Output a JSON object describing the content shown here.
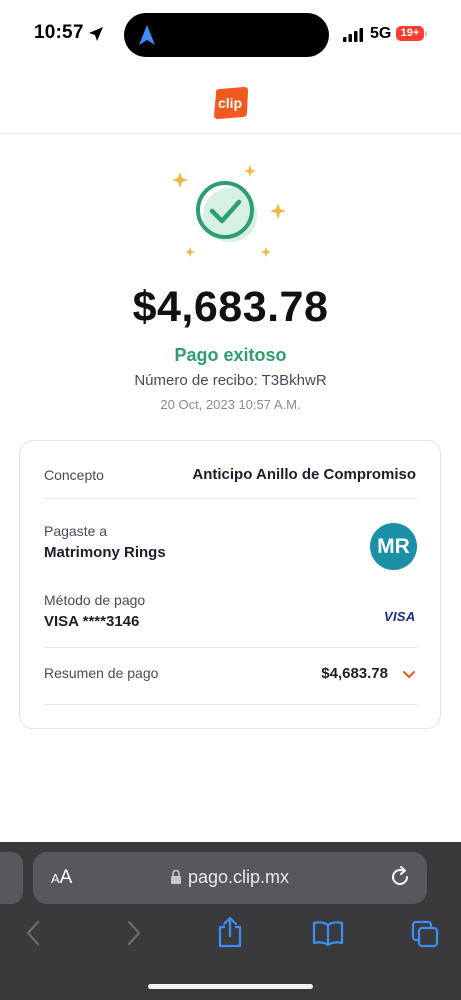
{
  "status_bar": {
    "time": "10:57",
    "network": "5G",
    "battery": "19+"
  },
  "header": {
    "logo_text": "clip"
  },
  "payment": {
    "amount": "$4,683.78",
    "status": "Pago exitoso",
    "receipt": "Número de recibo: T3BkhwR",
    "date": "20 Oct, 2023 10:57 A.M."
  },
  "details": {
    "concept_label": "Concepto",
    "concept_value": "Anticipo Anillo de Compromiso",
    "paid_to_label": "Pagaste a",
    "paid_to_value": "Matrimony Rings",
    "avatar_initials": "MR",
    "method_label": "Método de pago",
    "method_value": "VISA ****3146",
    "card_brand": "VISA",
    "summary_label": "Resumen de pago",
    "summary_value": "$4,683.78"
  },
  "browser": {
    "text_size_label": "AA",
    "url": "pago.clip.mx"
  },
  "colors": {
    "success_green": "#2e9e6e",
    "brand_orange": "#f05a1e",
    "avatar_teal": "#1b8fa6",
    "sparkle_yellow": "#f4b63b",
    "ios_blue": "#3a8ef6"
  },
  "icons": [
    "location-arrow-icon",
    "navigation-icon",
    "signal-icon",
    "check-circle-icon",
    "sparkle-icon",
    "chevron-down-icon",
    "lock-icon",
    "reload-icon",
    "back-icon",
    "forward-icon",
    "share-icon",
    "bookmarks-icon",
    "tabs-icon"
  ]
}
